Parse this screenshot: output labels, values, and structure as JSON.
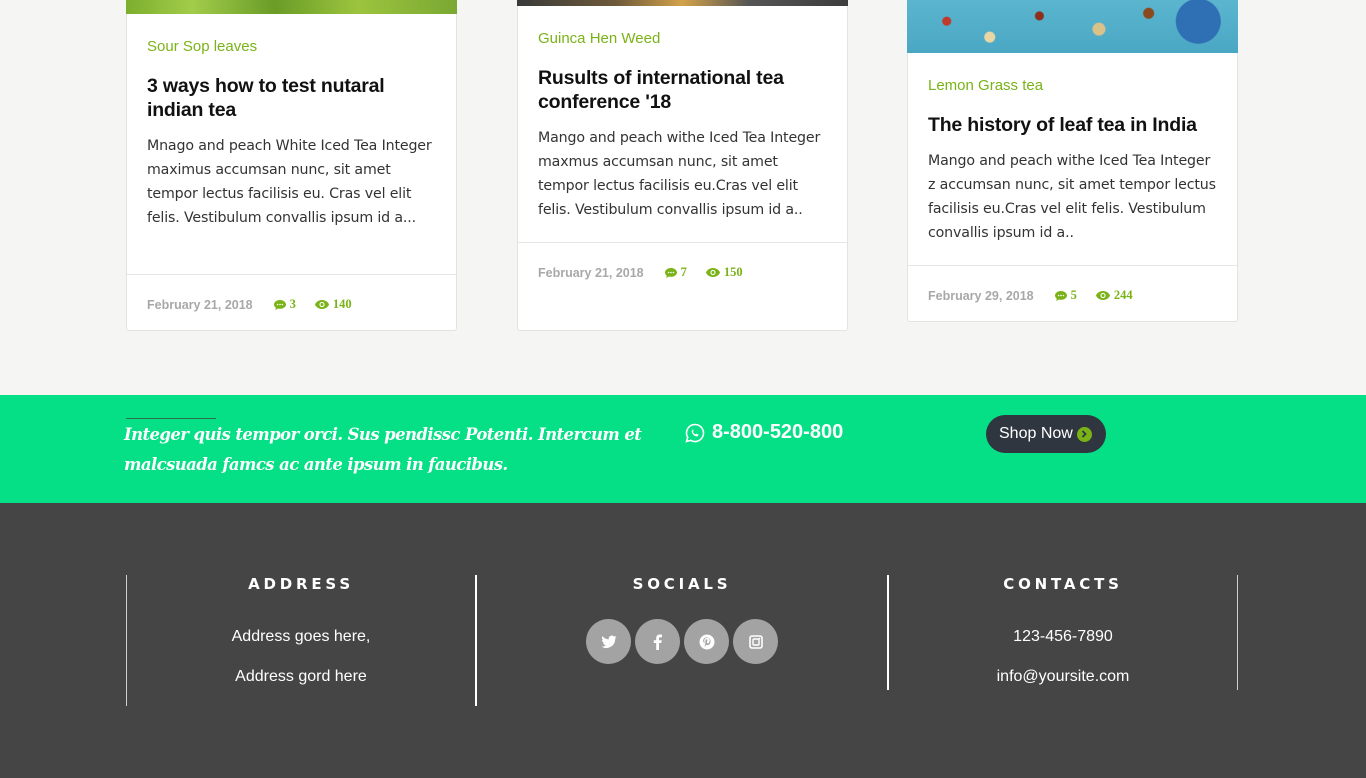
{
  "cards": [
    {
      "category": "Sour Sop leaves",
      "title": "3 ways how to test nutaral indian tea",
      "description": "Mnago and peach White Iced Tea Integer maximus accumsan nunc, sit amet tempor lectus facilisis eu. Cras vel elit felis. Vestibulum convallis ipsum id a...",
      "date": "February 21, 2018",
      "comments": "3",
      "views": "140"
    },
    {
      "category": "Guinca Hen Weed",
      "title": "Rusults of international tea conference '18",
      "description": "Mango and peach withe Iced Tea Integer maxmus accumsan nunc, sit amet tempor lectus facilisis eu.Cras vel elit felis. Vestibulum convallis ipsum id a..",
      "date": "February 21, 2018",
      "comments": "7",
      "views": "150"
    },
    {
      "category": "Lemon Grass tea",
      "title": "The history of leaf tea in India",
      "description": "Mango and peach withe Iced Tea Integer z accumsan nunc, sit amet tempor lectus facilisis eu.Cras vel elit felis. Vestibulum convallis ipsum id a..",
      "date": "February 29, 2018",
      "comments": "5",
      "views": "244"
    }
  ],
  "cta": {
    "tagline": "Integer quis tempor orci. Sus pendissc Potenti. Intercum et malcsuada famcs ac ante ipsum in faucibus.",
    "phone": "8-800-520-800",
    "shop_label": "Shop Now",
    "phone_icon": "whatsapp-icon"
  },
  "footer": {
    "address": {
      "heading": "ADDRESS",
      "line1": "Address goes here,",
      "line2": "Address gord here"
    },
    "socials": {
      "heading": "SOCIALS",
      "items": [
        "twitter-icon",
        "facebook-icon",
        "pinterest-icon",
        "instagram-icon"
      ]
    },
    "contacts": {
      "heading": "CONTACTS",
      "phone": "123-456-7890",
      "email": "info@yoursite.com"
    }
  },
  "colors": {
    "accent_green": "#7ab317",
    "cta_background": "#05e086",
    "footer_background": "#454545",
    "shop_button": "#303640",
    "page_background": "#f5f5f3"
  }
}
